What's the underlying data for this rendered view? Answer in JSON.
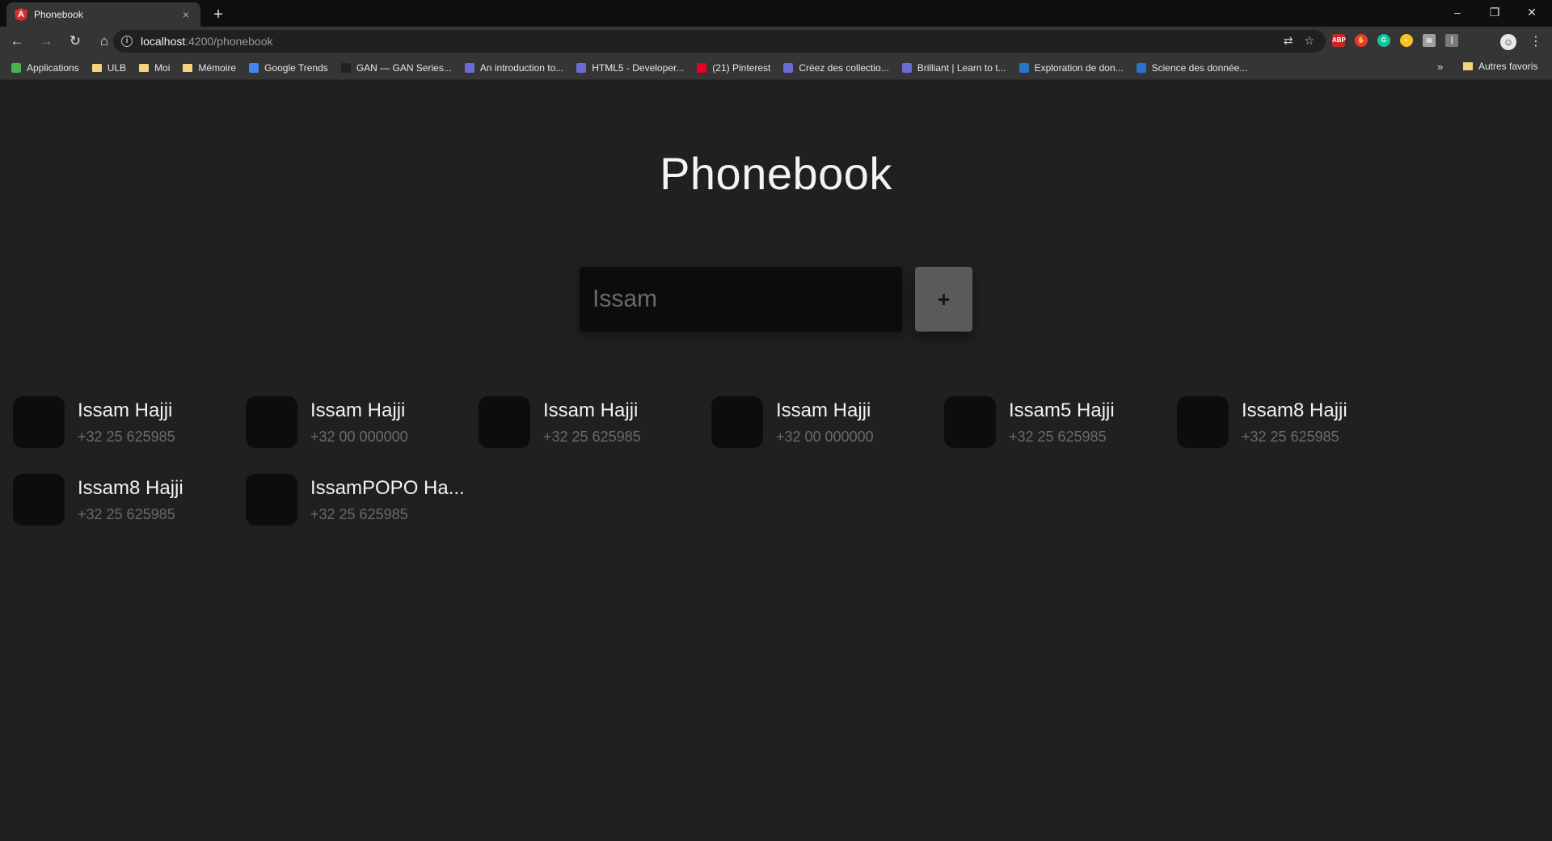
{
  "browser": {
    "tab_title": "Phonebook",
    "tab_favicon": "angular-icon",
    "url_host": "localhost",
    "url_path": ":4200/phonebook",
    "bookmarks": [
      {
        "label": "Applications",
        "icon": "apps-grid-icon"
      },
      {
        "label": "ULB",
        "icon": "folder-icon"
      },
      {
        "label": "Moi",
        "icon": "folder-icon"
      },
      {
        "label": "Mémoire",
        "icon": "folder-icon"
      },
      {
        "label": "Google Trends",
        "icon": "trends-icon"
      },
      {
        "label": "GAN — GAN Series...",
        "icon": "medium-icon"
      },
      {
        "label": "An introduction to...",
        "icon": "site-icon"
      },
      {
        "label": "HTML5 - Developer...",
        "icon": "site-icon"
      },
      {
        "label": "(21) Pinterest",
        "icon": "pinterest-icon"
      },
      {
        "label": "Créez des collectio...",
        "icon": "site-icon"
      },
      {
        "label": "Brilliant | Learn to t...",
        "icon": "site-icon"
      },
      {
        "label": "Exploration de don...",
        "icon": "coursera-icon"
      },
      {
        "label": "Science des donnée...",
        "icon": "coursera-icon"
      }
    ],
    "bookmarks_overflow": "»",
    "other_bookmarks": "Autres favoris"
  },
  "page": {
    "title": "Phonebook",
    "search_placeholder": "Issam",
    "add_label": "+"
  },
  "contacts": [
    {
      "name": "Issam Hajji",
      "phone": "+32 25 625985"
    },
    {
      "name": "Issam Hajji",
      "phone": "+32 00 000000"
    },
    {
      "name": "Issam Hajji",
      "phone": "+32 25 625985"
    },
    {
      "name": "Issam Hajji",
      "phone": "+32 00 000000"
    },
    {
      "name": "Issam5 Hajji",
      "phone": "+32 25 625985"
    },
    {
      "name": "Issam8 Hajji",
      "phone": "+32 25 625985"
    },
    {
      "name": "Issam8 Hajji",
      "phone": "+32 25 625985"
    },
    {
      "name": "IssamPOPO Ha...",
      "phone": "+32 25 625985"
    }
  ]
}
